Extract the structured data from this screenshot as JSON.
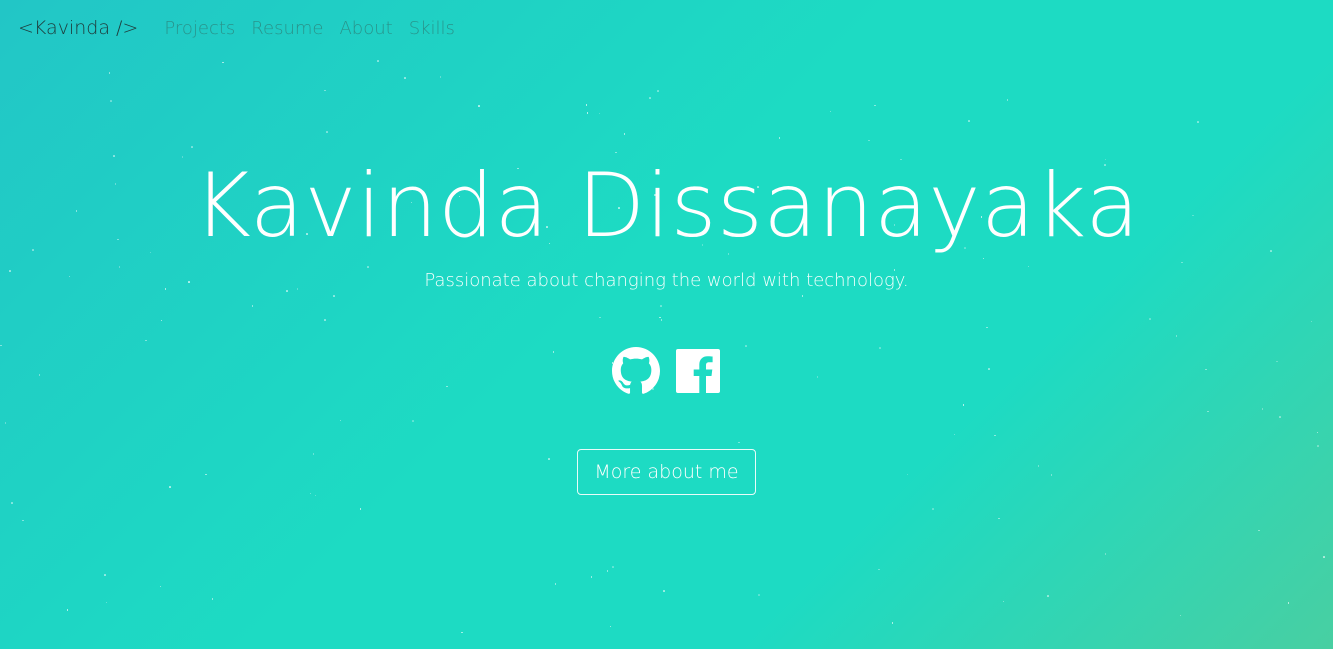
{
  "navbar": {
    "brand": "<Kavinda />",
    "links": [
      {
        "label": "Projects"
      },
      {
        "label": "Resume"
      },
      {
        "label": "About"
      },
      {
        "label": "Skills"
      }
    ]
  },
  "hero": {
    "title": "Kavinda Dissanayaka",
    "subtitle": "Passionate about changing the world with technology.",
    "socials": [
      {
        "icon": "github-icon"
      },
      {
        "icon": "facebook-icon"
      }
    ],
    "cta_label": "More about me"
  },
  "colors": {
    "background_start": "#22c6c6",
    "background_mid": "#1ddbc3",
    "background_end": "#48cfa2",
    "brand": "#1f3a3a",
    "nav_link": "#2b8a82",
    "text": "#ffffff"
  }
}
